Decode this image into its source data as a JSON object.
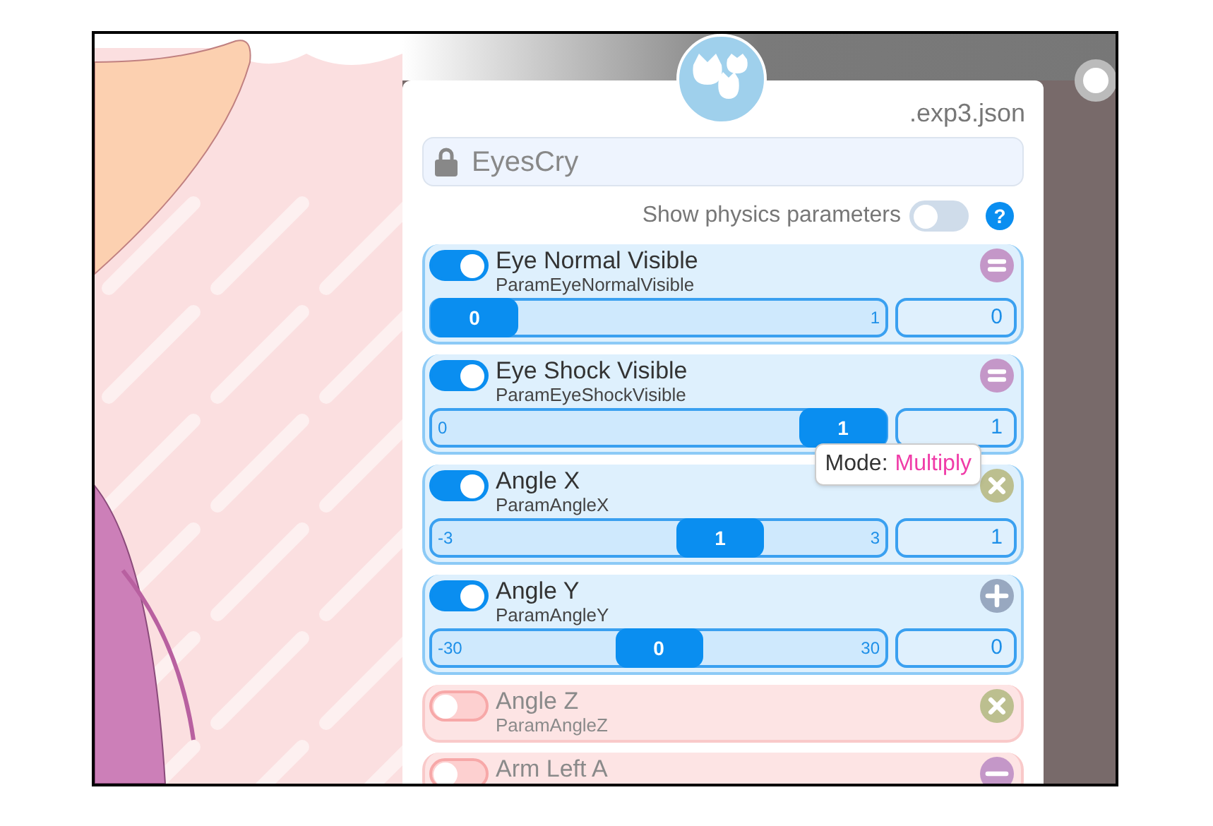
{
  "file_suffix": ".exp3.json",
  "name_field": {
    "value": "EyesCry",
    "locked": true
  },
  "physics_toggle": {
    "label": "Show physics parameters",
    "on": false,
    "help": "?"
  },
  "parameters": [
    {
      "name": "Eye Normal Visible",
      "id": "ParamEyeNormalVisible",
      "enabled": true,
      "kind": "equals",
      "slider": {
        "max_label": "1",
        "thumb": "0",
        "level": 0
      },
      "value": "0"
    },
    {
      "name": "Eye Shock Visible",
      "id": "ParamEyeShockVisible",
      "enabled": true,
      "kind": "equals",
      "slider": {
        "min_label": "0",
        "thumb": "1",
        "level": 1
      },
      "value": "1",
      "tooltip": {
        "label": "Mode:",
        "value": "Multiply"
      }
    },
    {
      "name": "Angle X",
      "id": "ParamAngleX",
      "enabled": true,
      "kind": "cross",
      "slider": {
        "min_label": "-3",
        "max_label": "3",
        "thumb": "1",
        "level": 0.667
      },
      "value": "1"
    },
    {
      "name": "Angle Y",
      "id": "ParamAngleY",
      "enabled": true,
      "kind": "plus",
      "slider": {
        "min_label": "-30",
        "max_label": "30",
        "thumb": "0",
        "level": 0.5
      },
      "value": "0"
    },
    {
      "name": "Angle Z",
      "id": "ParamAngleZ",
      "enabled": false,
      "kind": "cross"
    },
    {
      "name": "Arm Left A",
      "enabled": false,
      "kind": "minus"
    }
  ]
}
